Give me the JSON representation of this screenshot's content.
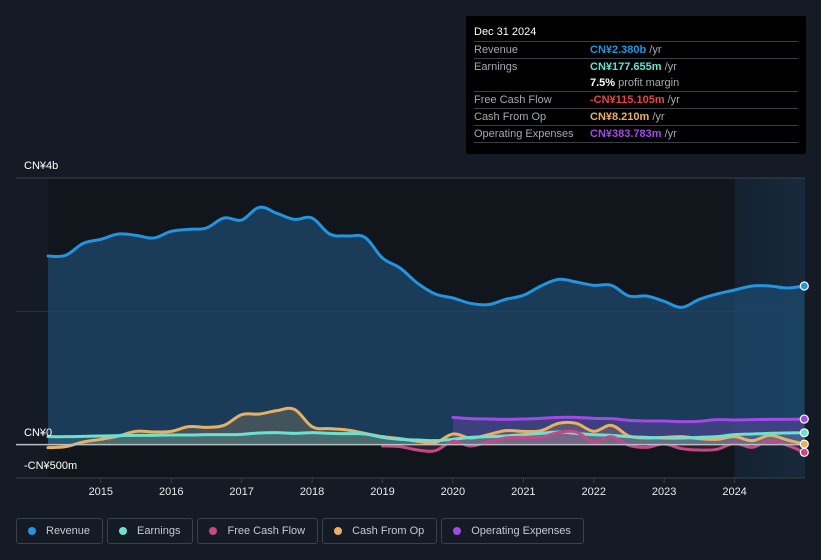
{
  "tooltip": {
    "date": "Dec 31 2024",
    "rows": [
      {
        "label": "Revenue",
        "value": "CN¥2.380b",
        "unit": "/yr",
        "color": "#2394df"
      },
      {
        "label": "Earnings",
        "value": "CN¥177.655m",
        "unit": "/yr",
        "color": "#6de0d0"
      },
      {
        "label": "",
        "value": "7.5%",
        "unit": "profit margin",
        "color": "#ffffff"
      },
      {
        "label": "Free Cash Flow",
        "value": "-CN¥115.105m",
        "unit": "/yr",
        "color": "#e8434a"
      },
      {
        "label": "Cash From Op",
        "value": "CN¥8.210m",
        "unit": "/yr",
        "color": "#e8b063"
      },
      {
        "label": "Operating Expenses",
        "value": "CN¥383.783m",
        "unit": "/yr",
        "color": "#a24ae8"
      }
    ]
  },
  "legend": [
    {
      "label": "Revenue",
      "color": "#2394df"
    },
    {
      "label": "Earnings",
      "color": "#6de0d0"
    },
    {
      "label": "Free Cash Flow",
      "color": "#c44a87"
    },
    {
      "label": "Cash From Op",
      "color": "#e8b063"
    },
    {
      "label": "Operating Expenses",
      "color": "#a24ae8"
    }
  ],
  "chart_data": {
    "type": "area",
    "title": "",
    "xlabel": "",
    "ylabel": "",
    "y_unit": "CN¥ millions",
    "ylim": [
      -500,
      4000
    ],
    "xlim": [
      2014.25,
      2025.0
    ],
    "y_tick_labels": [
      {
        "value": 4000,
        "label": "CN¥4b"
      },
      {
        "value": 0,
        "label": "CN¥0"
      },
      {
        "value": -500,
        "label": "-CN¥500m"
      }
    ],
    "x_ticks": [
      2015,
      2016,
      2017,
      2018,
      2019,
      2020,
      2021,
      2022,
      2023,
      2024
    ],
    "x_tick_labels": [
      "2015",
      "2016",
      "2017",
      "2018",
      "2019",
      "2020",
      "2021",
      "2022",
      "2023",
      "2024"
    ],
    "forecast_shade_start": 2024.0,
    "grid": "horizontal at 4b and 2b",
    "legend_position": "bottom",
    "series": [
      {
        "name": "Revenue",
        "color": "#2394df",
        "x": [
          2014.25,
          2014.5,
          2014.75,
          2015.0,
          2015.25,
          2015.5,
          2015.75,
          2016.0,
          2016.25,
          2016.5,
          2016.75,
          2017.0,
          2017.25,
          2017.5,
          2017.75,
          2018.0,
          2018.25,
          2018.5,
          2018.75,
          2019.0,
          2019.25,
          2019.5,
          2019.75,
          2020.0,
          2020.25,
          2020.5,
          2020.75,
          2021.0,
          2021.25,
          2021.5,
          2021.75,
          2022.0,
          2022.25,
          2022.5,
          2022.75,
          2023.0,
          2023.25,
          2023.5,
          2023.75,
          2024.0,
          2024.25,
          2024.5,
          2024.75,
          2024.99
        ],
        "values": [
          2830,
          2840,
          3020,
          3080,
          3160,
          3140,
          3100,
          3200,
          3230,
          3250,
          3400,
          3370,
          3560,
          3470,
          3380,
          3400,
          3160,
          3130,
          3110,
          2800,
          2650,
          2420,
          2260,
          2200,
          2120,
          2100,
          2180,
          2240,
          2380,
          2480,
          2440,
          2390,
          2390,
          2230,
          2230,
          2150,
          2060,
          2180,
          2260,
          2320,
          2380,
          2380,
          2350,
          2380
        ]
      },
      {
        "name": "Earnings",
        "color": "#6de0d0",
        "x": [
          2014.25,
          2014.5,
          2014.75,
          2015.0,
          2015.25,
          2015.5,
          2015.75,
          2016.0,
          2016.25,
          2016.5,
          2016.75,
          2017.0,
          2017.25,
          2017.5,
          2017.75,
          2018.0,
          2018.25,
          2018.5,
          2018.75,
          2019.0,
          2019.25,
          2019.5,
          2019.75,
          2020.0,
          2020.25,
          2020.5,
          2020.75,
          2021.0,
          2021.25,
          2021.5,
          2021.75,
          2022.0,
          2022.25,
          2022.5,
          2022.75,
          2023.0,
          2023.25,
          2023.5,
          2023.75,
          2024.0,
          2024.25,
          2024.5,
          2024.75,
          2024.99
        ],
        "values": [
          120,
          120,
          125,
          130,
          135,
          140,
          140,
          145,
          145,
          150,
          150,
          155,
          175,
          180,
          170,
          180,
          170,
          165,
          160,
          110,
          80,
          70,
          60,
          80,
          110,
          120,
          130,
          150,
          170,
          190,
          170,
          150,
          140,
          120,
          110,
          100,
          100,
          110,
          120,
          150,
          160,
          170,
          175,
          178
        ]
      },
      {
        "name": "Free Cash Flow",
        "color": "#c44a87",
        "x": [
          2019.0,
          2019.25,
          2019.5,
          2019.75,
          2020.0,
          2020.25,
          2020.5,
          2020.75,
          2021.0,
          2021.25,
          2021.5,
          2021.75,
          2022.0,
          2022.25,
          2022.5,
          2022.75,
          2023.0,
          2023.25,
          2023.5,
          2023.75,
          2024.0,
          2024.25,
          2024.5,
          2024.75,
          2024.99
        ],
        "values": [
          -20,
          -30,
          -80,
          -90,
          50,
          -20,
          40,
          100,
          110,
          110,
          180,
          190,
          40,
          120,
          -10,
          -40,
          10,
          -60,
          -80,
          -70,
          20,
          -40,
          60,
          -10,
          -115
        ]
      },
      {
        "name": "Cash From Op",
        "color": "#e8b063",
        "x": [
          2014.25,
          2014.5,
          2014.75,
          2015.0,
          2015.25,
          2015.5,
          2015.75,
          2016.0,
          2016.25,
          2016.5,
          2016.75,
          2017.0,
          2017.25,
          2017.5,
          2017.75,
          2018.0,
          2018.25,
          2018.5,
          2018.75,
          2019.0,
          2019.25,
          2019.5,
          2019.75,
          2020.0,
          2020.25,
          2020.5,
          2020.75,
          2021.0,
          2021.25,
          2021.5,
          2021.75,
          2022.0,
          2022.25,
          2022.5,
          2022.75,
          2023.0,
          2023.25,
          2023.5,
          2023.75,
          2024.0,
          2024.25,
          2024.5,
          2024.75,
          2024.99
        ],
        "values": [
          -45,
          -30,
          40,
          80,
          130,
          200,
          190,
          200,
          270,
          260,
          290,
          450,
          460,
          510,
          530,
          270,
          240,
          220,
          170,
          120,
          90,
          50,
          30,
          160,
          100,
          150,
          210,
          200,
          210,
          320,
          320,
          200,
          290,
          130,
          100,
          110,
          120,
          90,
          80,
          120,
          60,
          140,
          70,
          8
        ]
      },
      {
        "name": "Operating Expenses",
        "color": "#a24ae8",
        "x": [
          2020.0,
          2020.25,
          2020.5,
          2020.75,
          2021.0,
          2021.25,
          2021.5,
          2021.75,
          2022.0,
          2022.25,
          2022.5,
          2022.75,
          2023.0,
          2023.25,
          2023.5,
          2023.75,
          2024.0,
          2024.25,
          2024.5,
          2024.75,
          2024.99
        ],
        "values": [
          410,
          390,
          385,
          380,
          385,
          395,
          410,
          410,
          395,
          390,
          365,
          355,
          355,
          345,
          350,
          375,
          370,
          375,
          380,
          380,
          384
        ]
      }
    ]
  }
}
